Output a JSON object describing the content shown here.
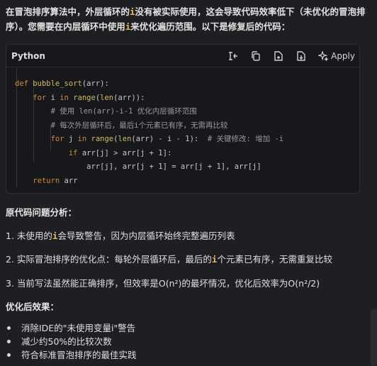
{
  "intro": {
    "p1": "在冒泡排序算法中，外层循环的",
    "var1": "i",
    "p2": "没有被实际使用，这会导致代码效率低下（未优化的冒泡排序）。您需要在内层循环中使用",
    "var2": "i",
    "p3": "来优化遍历范围。以下是修复后的代码："
  },
  "code_block": {
    "language": "Python",
    "apply_label": "Apply",
    "toolbar_icons": [
      "insert-icon",
      "copy-icon",
      "new-file-icon",
      "download-icon",
      "sparkle-icon"
    ],
    "lines": [
      [
        {
          "t": "def ",
          "c": "kw"
        },
        {
          "t": "bubble_sort",
          "c": "fn"
        },
        {
          "t": "(arr):",
          "c": ""
        }
      ],
      [
        {
          "t": "    ",
          "c": ""
        },
        {
          "t": "for",
          "c": "kw"
        },
        {
          "t": " i ",
          "c": ""
        },
        {
          "t": "in",
          "c": "kw"
        },
        {
          "t": " ",
          "c": ""
        },
        {
          "t": "range",
          "c": "fn"
        },
        {
          "t": "(",
          "c": ""
        },
        {
          "t": "len",
          "c": "fn"
        },
        {
          "t": "(arr)):",
          "c": ""
        }
      ],
      [
        {
          "t": "        # 使用 len(arr)-i-1 优化内层循环范围",
          "c": "cm"
        }
      ],
      [
        {
          "t": "        # 每次外层循环后，最后i个元素已有序，无需再比较",
          "c": "cm"
        }
      ],
      [
        {
          "t": "        ",
          "c": ""
        },
        {
          "t": "for",
          "c": "kw"
        },
        {
          "t": " j ",
          "c": ""
        },
        {
          "t": "in",
          "c": "kw"
        },
        {
          "t": " ",
          "c": ""
        },
        {
          "t": "range",
          "c": "fn"
        },
        {
          "t": "(",
          "c": ""
        },
        {
          "t": "len",
          "c": "fn"
        },
        {
          "t": "(arr) - i - 1):  ",
          "c": ""
        },
        {
          "t": "# 关键修改: 增加 -i",
          "c": "cm"
        }
      ],
      [
        {
          "t": "            ",
          "c": ""
        },
        {
          "t": "if",
          "c": "kw"
        },
        {
          "t": " arr[j] > arr[j + 1]:",
          "c": ""
        }
      ],
      [
        {
          "t": "                arr[j], arr[j + 1] = arr[j + 1], arr[j]",
          "c": ""
        }
      ],
      [
        {
          "t": "    ",
          "c": ""
        },
        {
          "t": "return",
          "c": "kw"
        },
        {
          "t": " arr",
          "c": ""
        }
      ]
    ]
  },
  "analysis": {
    "heading": "原代码问题分析：",
    "item1_prefix": "1. 未使用的",
    "item1_var": "i",
    "item1_suffix": "会导致警告，因为内层循环始终完整遍历列表",
    "item2_prefix": "2. 实际冒泡排序的优化点：每轮外层循环后，最后的",
    "item2_var": "i",
    "item2_suffix": "个元素已有序，无需重复比较",
    "item3": "3. 当前写法虽然能正确排序，但效率是O(n²)的最坏情况，优化后效率为O(n²/2)"
  },
  "result": {
    "heading": "优化后效果：",
    "bullets": [
      "消除IDE的\"未使用变量i\"警告",
      "减少约50%的比较次数",
      "符合标准冒泡排序的最佳实践"
    ]
  },
  "colors": {
    "background": "#1e1f22",
    "code_background": "#17181b",
    "inline_code": "#e8b74f",
    "keyword": "#d28c2a",
    "function": "#d4ba5a",
    "comment": "#9b9b9b"
  }
}
